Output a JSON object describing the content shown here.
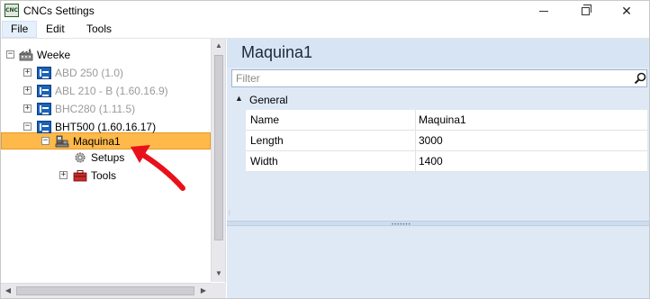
{
  "window": {
    "title": "CNCs Settings",
    "app_icon_text": "CNC",
    "close_glyph": "✕"
  },
  "menu": {
    "items": [
      {
        "label": "File",
        "active": true
      },
      {
        "label": "Edit",
        "active": false
      },
      {
        "label": "Tools",
        "active": false
      }
    ]
  },
  "tree": {
    "root": {
      "label": "Weeke",
      "expander": "⊟",
      "icon": "factory-icon"
    },
    "machines": [
      {
        "label": "ABD 250 (1.0)",
        "expander": "+",
        "enabled": false,
        "icon": "kc-machine-icon"
      },
      {
        "label": "ABL 210 - B (1.60.16.9)",
        "expander": "+",
        "enabled": false,
        "icon": "kc-machine-icon"
      },
      {
        "label": "BHC280 (1.11.5)",
        "expander": "+",
        "enabled": false,
        "icon": "kc-machine-icon"
      },
      {
        "label": "BHT500 (1.60.16.17)",
        "expander": "−",
        "enabled": true,
        "icon": "kc-machine-icon"
      }
    ],
    "selected": {
      "label": "Maquina1",
      "expander": "−",
      "icon": "machine-tool-icon"
    },
    "children": [
      {
        "label": "Setups",
        "icon": "gear-icon"
      },
      {
        "label": "Tools",
        "expander": "+",
        "icon": "toolbox-icon"
      }
    ]
  },
  "props": {
    "title": "Maquina1",
    "filter_placeholder": "Filter",
    "category": {
      "label": "General",
      "toggle": "▲"
    },
    "rows": [
      {
        "name": "Name",
        "value": "Maquina1"
      },
      {
        "name": "Length",
        "value": "3000"
      },
      {
        "name": "Width",
        "value": "1400"
      }
    ],
    "splitter_grip": "•••••••"
  },
  "scroll": {
    "up": "▲",
    "down": "▼",
    "left": "◀",
    "right": "▶"
  },
  "colors": {
    "selection": "#ffb94a",
    "machine_icon": "#1b62b8",
    "annotation": "#e8111b",
    "pane_background": "#dfe9f5"
  }
}
